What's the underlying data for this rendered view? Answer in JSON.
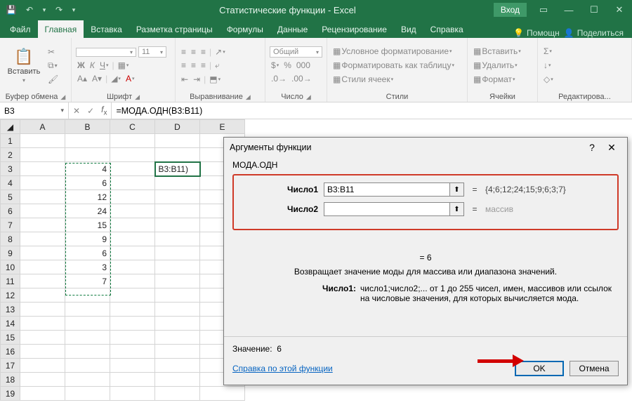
{
  "title": "Статистические функции  -  Excel",
  "login": "Вход",
  "tabs": {
    "file": "Файл",
    "home": "Главная",
    "insert": "Вставка",
    "layout": "Разметка страницы",
    "formulas": "Формулы",
    "data": "Данные",
    "review": "Рецензирование",
    "view": "Вид",
    "help": "Справка",
    "assist": "Помощн",
    "share": "Поделиться"
  },
  "ribbon": {
    "paste": "Вставить",
    "clipboard": "Буфер обмена",
    "font_group": "Шрифт",
    "align_group": "Выравнивание",
    "number_group": "Число",
    "styles_group": "Стили",
    "cells_group": "Ячейки",
    "editing_group": "Редактирова...",
    "font_size": "11",
    "number_format": "Общий",
    "cond_fmt": "Условное форматирование",
    "fmt_table": "Форматировать как таблицу",
    "cell_styles": "Стили ячеек",
    "insert_cell": "Вставить",
    "delete_cell": "Удалить",
    "format_cell": "Формат"
  },
  "namebox": "B3",
  "formula": "=МОДА.ОДН(B3:B11)",
  "columns": [
    "A",
    "B",
    "C",
    "D",
    "E"
  ],
  "cells": {
    "b": [
      "4",
      "6",
      "12",
      "24",
      "15",
      "9",
      "6",
      "3",
      "7"
    ],
    "d3": "B3:B11)"
  },
  "dialog": {
    "title": "Аргументы функции",
    "fname": "МОДА.ОДН",
    "arg1_label": "Число1",
    "arg1_value": "B3:B11",
    "arg1_result": "{4;6;12;24;15;9;6;3;7}",
    "arg2_label": "Число2",
    "arg2_value": "",
    "arg2_result": "массив",
    "eq": "=",
    "center_result": "=   6",
    "description": "Возвращает значение моды для массива или диапазона значений.",
    "argdesc_label": "Число1:",
    "argdesc_text": "число1;число2;... от 1 до 255 чисел, имен, массивов или ссылок на числовые значения, для которых вычисляется мода.",
    "value_label": "Значение:",
    "value": "6",
    "help_link": "Справка по этой функции",
    "ok": "OK",
    "cancel": "Отмена"
  }
}
